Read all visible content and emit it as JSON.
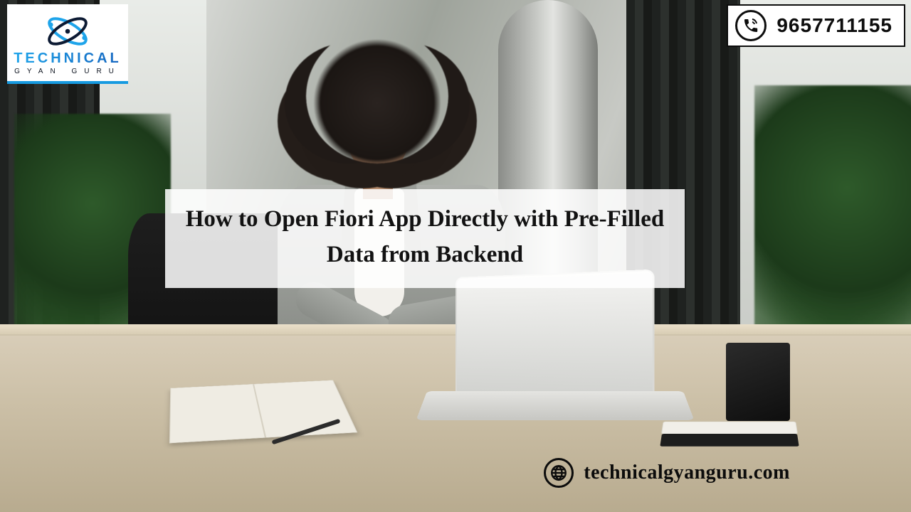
{
  "logo": {
    "main": "TECHNICAL",
    "sub": "GYAN GURU"
  },
  "contact": {
    "phone": "9657711155"
  },
  "headline": {
    "line1": "How to Open Fiori App Directly with Pre-Filled",
    "line2": "Data from Backend"
  },
  "footer": {
    "url": "technicalgyanguru.com"
  }
}
